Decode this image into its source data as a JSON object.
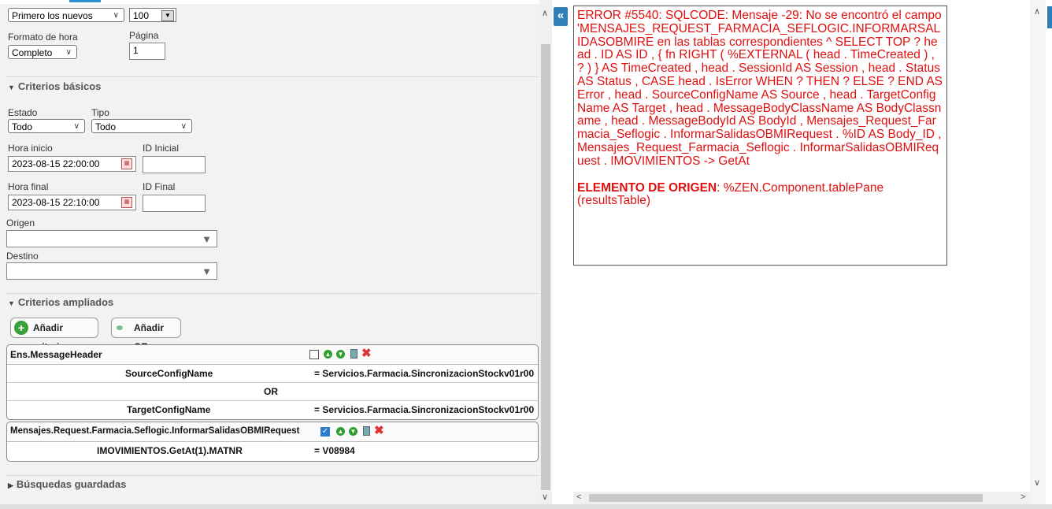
{
  "filters": {
    "order_value": "Primero los nuevos",
    "count_value": "100",
    "hour_format_label": "Formato de hora",
    "hour_format_value": "Completo",
    "page_label": "Página",
    "page_value": "1"
  },
  "basic": {
    "title": "Criterios básicos",
    "status_label": "Estado",
    "status_value": "Todo",
    "type_label": "Tipo",
    "type_value": "Todo",
    "start_label": "Hora inicio",
    "start_value": "2023-08-15 22:00:00",
    "id_start_label": "ID Inicial",
    "id_start_value": "",
    "end_label": "Hora final",
    "end_value": "2023-08-15 22:10:00",
    "id_end_label": "ID Final",
    "id_end_value": "",
    "source_label": "Origen",
    "source_value": "",
    "target_label": "Destino",
    "target_value": ""
  },
  "extended": {
    "title": "Criterios ampliados",
    "add_criterion_label": "Añadir criterio",
    "add_or_label": "Añadir OR",
    "panel1": {
      "title": "Ens.MessageHeader",
      "checked": false,
      "rows": [
        {
          "field": "SourceConfigName",
          "value": "= Servicios.Farmacia.SincronizacionStockv01r00"
        },
        {
          "field": "",
          "op": "OR"
        },
        {
          "field": "TargetConfigName",
          "value": "= Servicios.Farmacia.SincronizacionStockv01r00"
        }
      ]
    },
    "panel2": {
      "title": "Mensajes.Request.Farmacia.Seflogic.InformarSalidasOBMIRequest",
      "checked": true,
      "rows": [
        {
          "field": "IMOVIMIENTOS.GetAt(1).MATNR",
          "value": "= V08984"
        }
      ]
    }
  },
  "saved": {
    "title": "Búsquedas guardadas"
  },
  "error": {
    "message": "ERROR #5540: SQLCODE: Mensaje -29: No se encontró el campo 'MENSAJES_REQUEST_FARMACIA_SEFLOGIC.INFORMARSALIDASOBMIRE en las tablas correspondientes ^ SELECT TOP ? head . ID AS ID , { fn RIGHT ( %EXTERNAL ( head . TimeCreated ) , ? ) } AS TimeCreated , head . SessionId AS Session , head . Status AS Status , CASE head . IsError WHEN ? THEN ? ELSE ? END AS Error , head . SourceConfigName AS Source , head . TargetConfigName AS Target , head . MessageBodyClassName AS BodyClassname , head . MessageBodyId AS BodyId , Mensajes_Request_Farmacia_Seflogic . InformarSalidasOBMIRequest . %ID AS Body_ID , Mensajes_Request_Farmacia_Seflogic . InformarSalidasOBMIRequest . IMOVIMIENTOS -> GetAt",
    "origin_label": "ELEMENTO DE ORIGEN",
    "origin_value": ": %ZEN.Component.tablePane (resultsTable)",
    "color": "#e01010"
  },
  "icons": {
    "collapse": "double-chevron-left-icon",
    "calendar": "calendar-icon",
    "add": "plus-circle-icon",
    "delete": "x-icon"
  }
}
